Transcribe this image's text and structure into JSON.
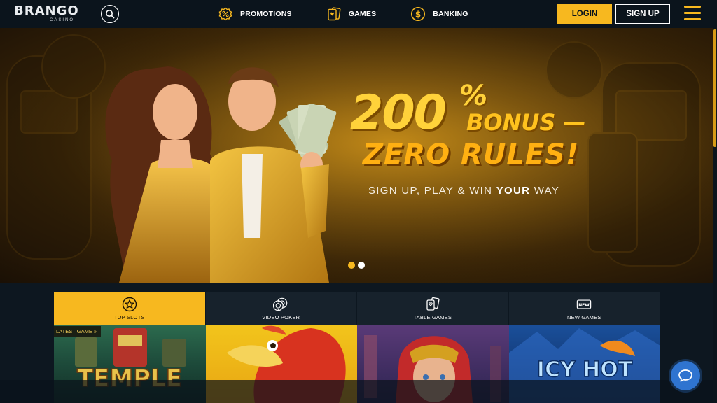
{
  "header": {
    "logo_text": "BRANGO",
    "logo_sub": "CASINO",
    "search_icon": "search-icon",
    "nav": [
      {
        "label": "PROMOTIONS",
        "icon": "percent-badge-icon"
      },
      {
        "label": "GAMES",
        "icon": "cards-icon"
      },
      {
        "label": "BANKING",
        "icon": "dollar-coin-icon"
      }
    ],
    "login_label": "LOGIN",
    "signup_label": "SIGN UP",
    "menu_icon": "hamburger-menu-icon"
  },
  "hero": {
    "headline_number": "200",
    "headline_percent": "%",
    "headline_bonus": "BONUS —",
    "headline_zero": "ZERO RULES!",
    "subtitle_pre": "SIGN UP, PLAY & WIN ",
    "subtitle_bold": "YOUR",
    "subtitle_post": " WAY",
    "slide_count": 2,
    "active_slide": 1
  },
  "categories": [
    {
      "label": "TOP SLOTS",
      "icon": "star-badge-icon",
      "active": true
    },
    {
      "label": "VIDEO POKER",
      "icon": "poker-chips-icon",
      "active": false
    },
    {
      "label": "TABLE GAMES",
      "icon": "playing-cards-icon",
      "active": false
    },
    {
      "label": "NEW GAMES",
      "icon": "new-badge-icon",
      "active": false
    }
  ],
  "tiles": {
    "latest_badge": "LATEST GAME",
    "latest_arrow": "»"
  },
  "colors": {
    "accent": "#f7b81f",
    "header_bg": "#0b141c",
    "page_bg": "#0d1720",
    "chat_blue": "#2f74d0"
  },
  "chat_icon": "chat-bubble-icon"
}
